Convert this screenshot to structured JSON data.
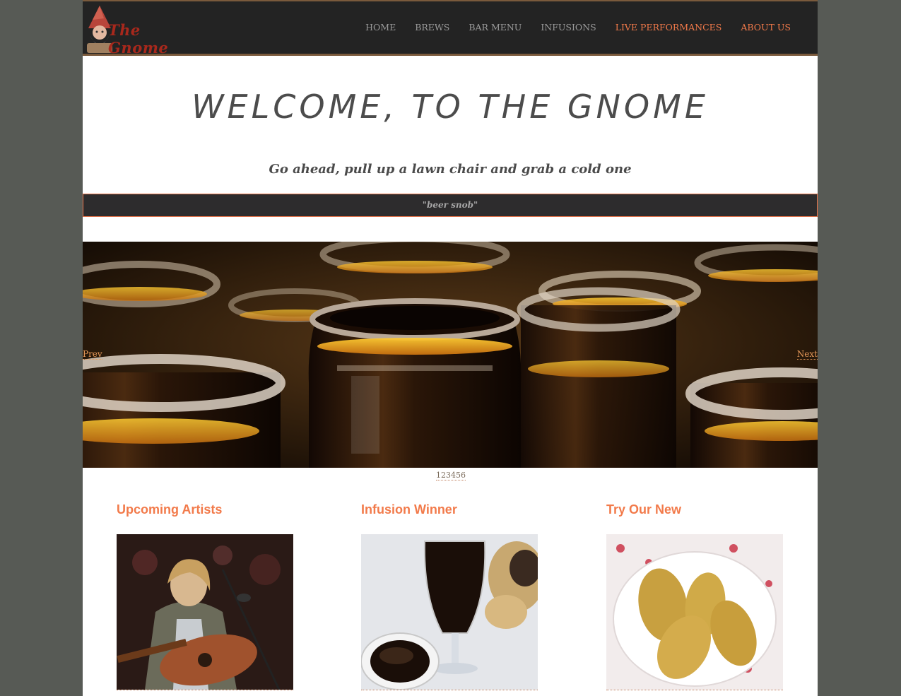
{
  "header": {
    "logo_text": "The Gnome",
    "nav": [
      {
        "label": "HOME",
        "accent": false
      },
      {
        "label": "BREWS",
        "accent": false
      },
      {
        "label": "BAR MENU",
        "accent": false
      },
      {
        "label": "INFUSIONS",
        "accent": false
      },
      {
        "label": "LIVE PERFORMANCES",
        "accent": true
      },
      {
        "label": "ABOUT US",
        "accent": true
      }
    ]
  },
  "hero": {
    "title": "WELCOME, TO THE GNOME",
    "tagline": "Go ahead, pull up a lawn chair and grab a cold one",
    "quote": "\"beer snob\""
  },
  "slider": {
    "prev_label": "Prev",
    "next_label": "Next",
    "pager": "123456"
  },
  "columns": [
    {
      "title": "Upcoming Artists"
    },
    {
      "title": "Infusion Winner"
    },
    {
      "title": "Try Our New"
    }
  ],
  "colors": {
    "accent": "#f27a4a",
    "header_bg": "#232323",
    "page_bg": "#575a55"
  }
}
